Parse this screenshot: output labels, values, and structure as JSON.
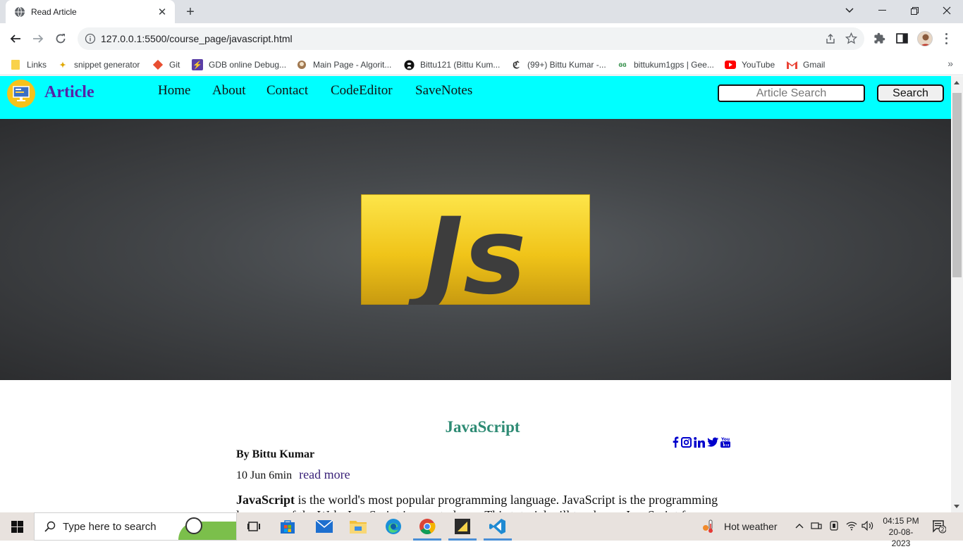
{
  "browser": {
    "tab_title": "Read Article",
    "url": "127.0.0.1:5500/course_page/javascript.html",
    "bookmarks": [
      {
        "label": "Links",
        "icon": "folder-icon"
      },
      {
        "label": "snippet generator",
        "icon": "snippet-icon"
      },
      {
        "label": "Git",
        "icon": "git-icon"
      },
      {
        "label": "GDB online Debug...",
        "icon": "gdb-icon"
      },
      {
        "label": "Main Page - Algorit...",
        "icon": "algorithmica-icon"
      },
      {
        "label": "Bittu121 (Bittu Kum...",
        "icon": "github-icon"
      },
      {
        "label": "(99+) Bittu Kumar -...",
        "icon": "leetcode-icon"
      },
      {
        "label": "bittukum1gps | Gee...",
        "icon": "geeksforgeeks-icon"
      },
      {
        "label": "YouTube",
        "icon": "youtube-icon"
      },
      {
        "label": "Gmail",
        "icon": "gmail-icon"
      }
    ]
  },
  "site": {
    "brand": "Article",
    "menu": [
      "Home",
      "About",
      "Contact",
      "CodeEditor",
      "SaveNotes"
    ],
    "search_placeholder": "Article Search",
    "search_button": "Search"
  },
  "hero": {
    "logo_text": "Js"
  },
  "article": {
    "title": "JavaScript",
    "author": "By Bittu Kumar",
    "date_length": "10 Jun 6min",
    "read_more": "read more",
    "lead_bold": "JavaScript",
    "lead_text": " is the world's most popular programming language. JavaScript is the programming language of the Web. JavaScript is easy to learn. This tutorial will teach you JavaScript from"
  },
  "taskbar": {
    "search_placeholder": "Type here to search",
    "weather": "Hot weather",
    "time": "04:15 PM",
    "date": "20-08-2023",
    "notification_count": "2"
  },
  "colors": {
    "site_nav_bg": "#00ffff",
    "brand": "#5523a8",
    "article_title": "#2e8b74",
    "social_icons": "#0000cc",
    "js_logo": "#f0c419"
  }
}
